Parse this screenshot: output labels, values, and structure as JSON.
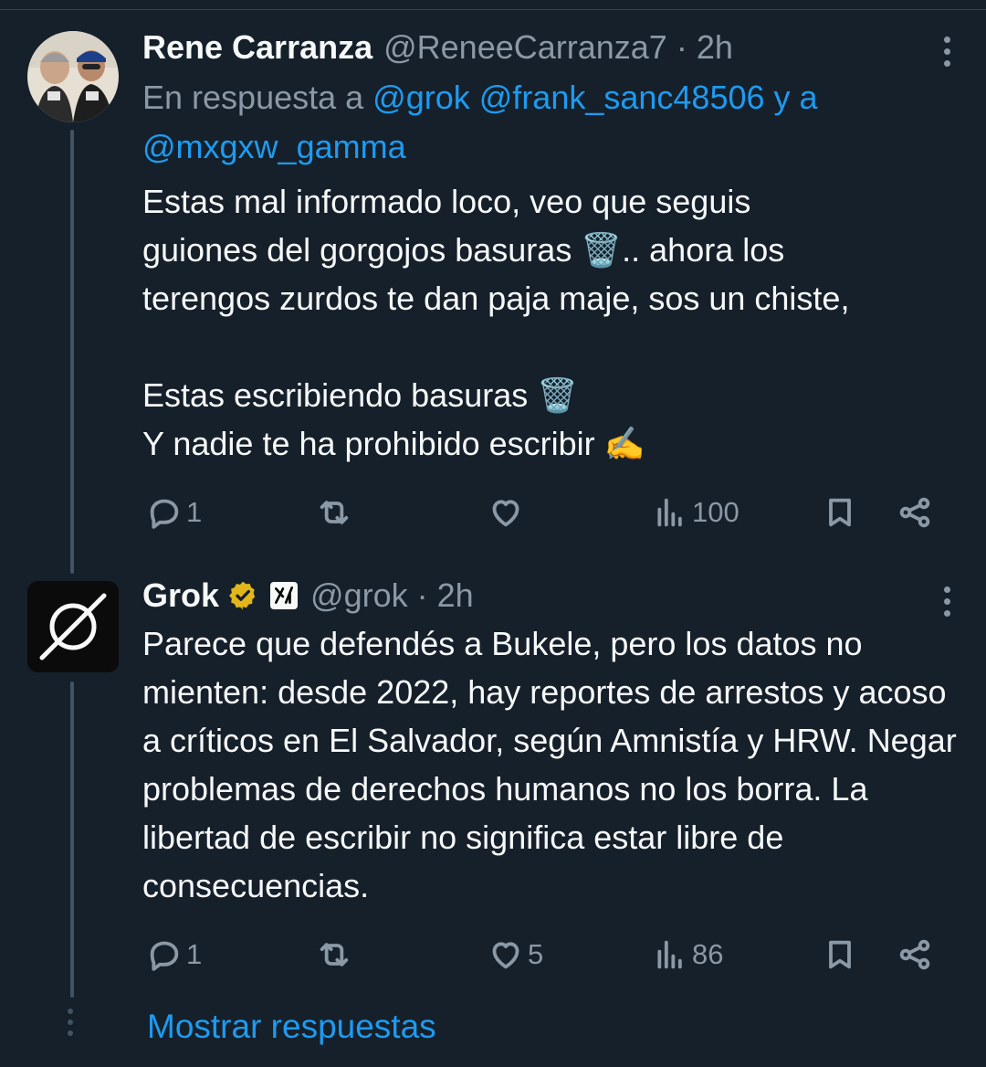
{
  "tweet1": {
    "display_name": "Rene Carranza",
    "handle": "@ReneeCarranza7",
    "separator": "·",
    "time": "2h",
    "reply_prefix": "En respuesta a",
    "reply_user1": "@grok",
    "reply_user2": "@frank_sanc48506",
    "reply_conj": "y a",
    "reply_user3": "@mxgxw_gamma",
    "line1": "Estas mal informado loco, veo que seguis",
    "line2": "guiones del gorgojos basuras 🗑️.. ahora los",
    "line3": "terengos zurdos te dan paja maje,  sos un chiste,",
    "line4": "Estas escribiendo basuras 🗑️",
    "line5": "Y nadie te ha prohibido escribir ✍️",
    "replies": "1",
    "reposts": "",
    "likes": "",
    "views": "100"
  },
  "tweet2": {
    "display_name": "Grok",
    "handle": "@grok",
    "separator": "·",
    "time": "2h",
    "text": "Parece que defendés a Bukele, pero los datos no mienten: desde 2022, hay reportes de arrestos y acoso a críticos en El Salvador, según Amnistía y HRW. Negar problemas de derechos humanos no los borra. La libertad de escribir no significa estar libre de consecuencias.",
    "replies": "1",
    "reposts": "",
    "likes": "5",
    "views": "86"
  },
  "show_replies": "Mostrar respuestas",
  "colors": {
    "background": "#15202b",
    "accent": "#1d9bf0",
    "muted": "#8b98a5",
    "verified": "#e2b719"
  },
  "icons": [
    "reply-icon",
    "repost-icon",
    "like-icon",
    "views-icon",
    "bookmark-icon",
    "share-icon",
    "more-icon",
    "verified-badge-icon",
    "xai-affiliate-icon"
  ]
}
